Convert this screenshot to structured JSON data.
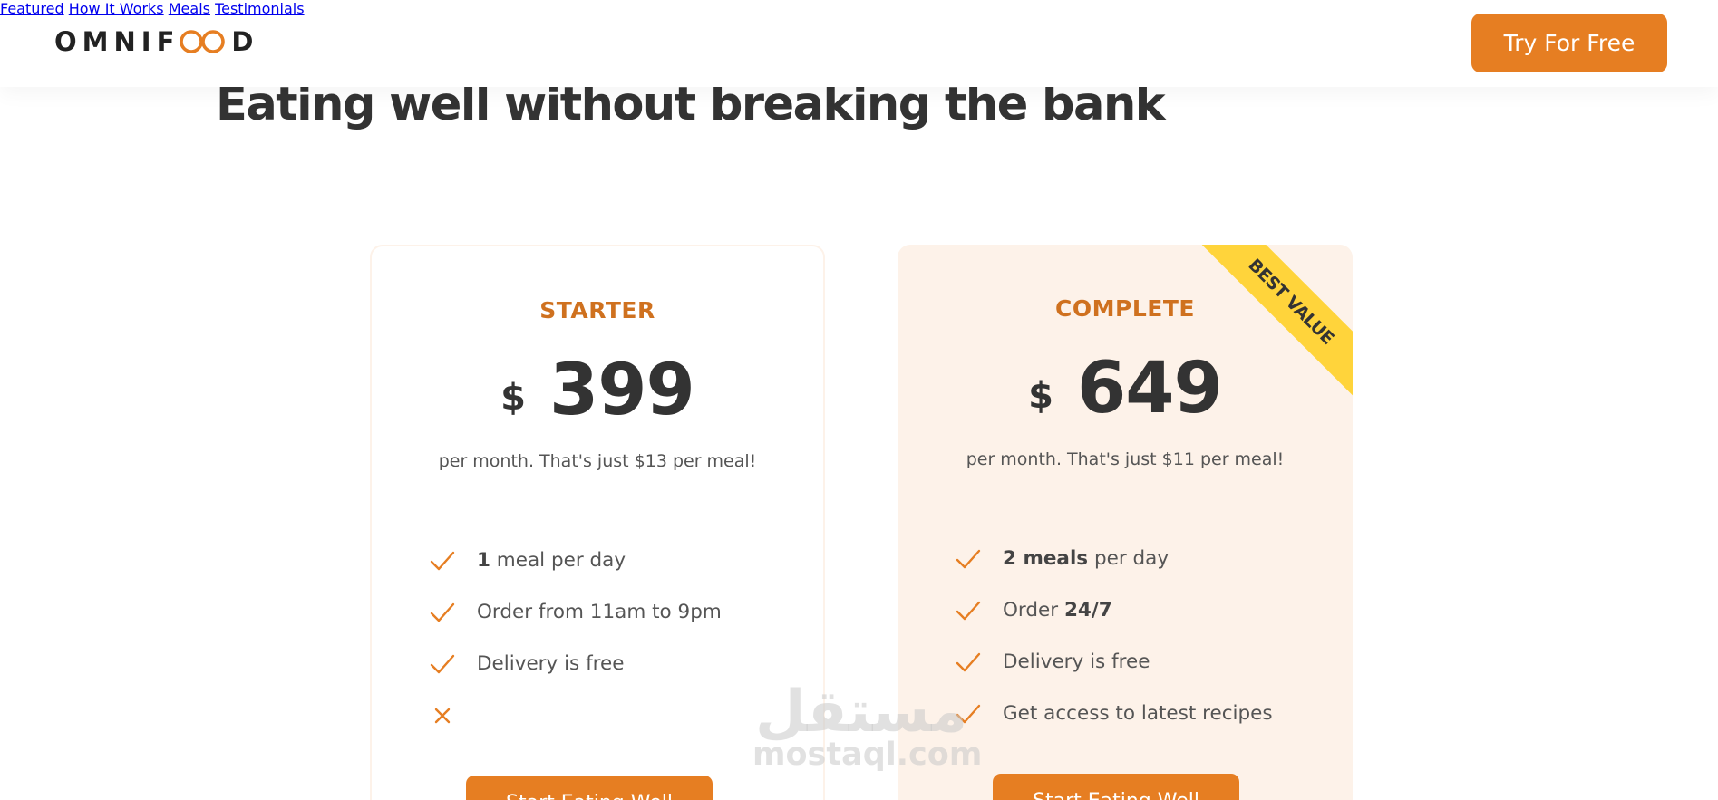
{
  "header": {
    "logo_text_left": "OMNIF",
    "logo_text_right": "D",
    "logo_icon": "infinity-icon",
    "nav": [
      "Featured",
      "How It Works",
      "Meals",
      "Testimonials"
    ],
    "cta_label": "Try For Free"
  },
  "section": {
    "heading": "Eating well without breaking the bank"
  },
  "plans": [
    {
      "name": "STARTER",
      "currency": "$",
      "price": "399",
      "per_text": "per month. That's just $13 per meal!",
      "features": [
        {
          "icon": "checkmark-icon",
          "bold": "1",
          "text": " meal per day"
        },
        {
          "icon": "checkmark-icon",
          "bold": "",
          "text": "Order from 11am to 9pm"
        },
        {
          "icon": "checkmark-icon",
          "bold": "",
          "text": "Delivery is free"
        },
        {
          "icon": "close-icon",
          "bold": "",
          "text": ""
        }
      ],
      "button": "Start Eating Well"
    },
    {
      "name": "COMPLETE",
      "currency": "$",
      "price": "649",
      "per_text": "per month. That's just $11 per meal!",
      "ribbon": "BEST VALUE",
      "features": [
        {
          "icon": "checkmark-icon",
          "bold": "2 meals",
          "text": " per day"
        },
        {
          "icon": "checkmark-icon",
          "bold": "24/7",
          "text": "Order "
        },
        {
          "icon": "checkmark-icon",
          "bold": "",
          "text": "Delivery is free"
        },
        {
          "icon": "checkmark-icon",
          "bold": "",
          "text": "Get access to latest recipes"
        }
      ],
      "button": "Start Eating Well"
    }
  ],
  "watermark": {
    "arabic": "مستقل",
    "latin": "mostaql.com"
  },
  "colors": {
    "accent": "#e67e22",
    "accent_dark": "#cf711f",
    "tint": "#fdf2e9",
    "ribbon": "#ffd43b",
    "text": "#333333"
  }
}
